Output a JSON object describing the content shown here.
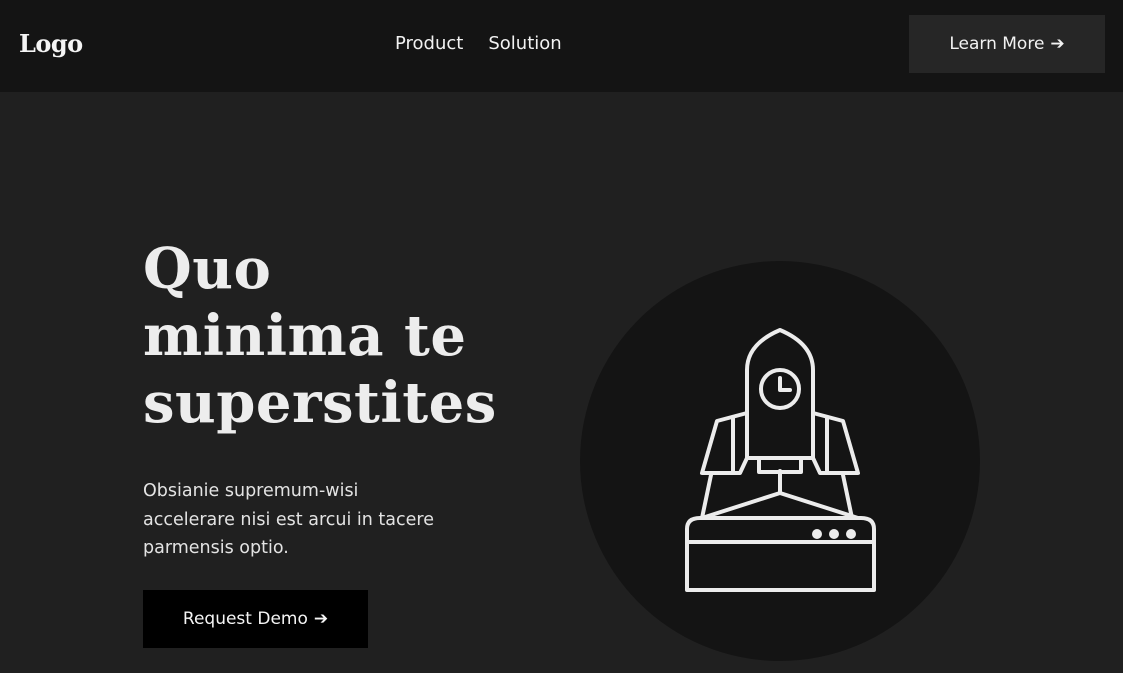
{
  "navbar": {
    "logo": "Logo",
    "links": [
      {
        "label": "Product"
      },
      {
        "label": "Solution"
      }
    ],
    "cta_label": "Learn More",
    "cta_arrow": "➔"
  },
  "hero": {
    "title_lines": [
      "Quo",
      "minima te",
      "superstites"
    ],
    "description_lines": [
      "Obsianie supremum-wisi",
      "accelerare nisi est arcui in tacere",
      "parmensis optio."
    ],
    "cta_label": "Request Demo",
    "cta_arrow": "➔",
    "illustration_icon": "rocket-launch-icon"
  },
  "colors": {
    "navbar_bg": "#141414",
    "page_bg": "#202020",
    "nav_button_bg": "#262626",
    "primary_button_bg": "#000000",
    "circle_bg": "#141414",
    "text": "#ececec"
  }
}
